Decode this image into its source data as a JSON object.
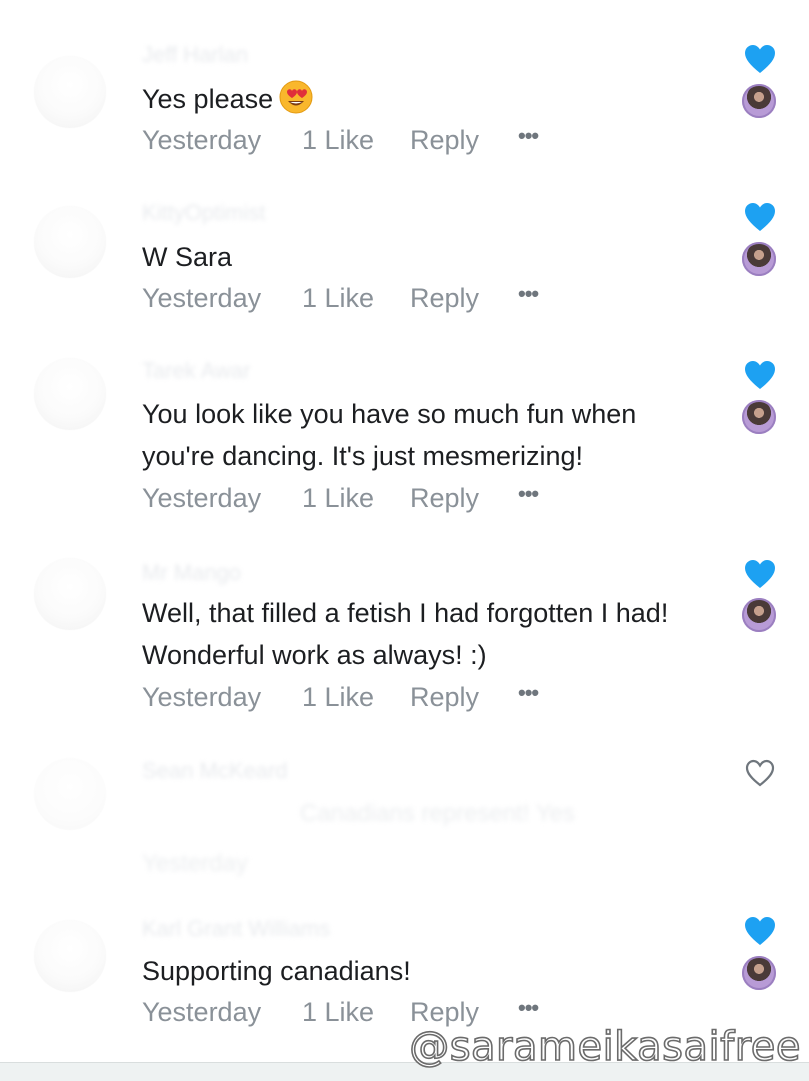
{
  "comments": [
    {
      "author": "Jeff Harlan",
      "text": "Yes please",
      "emoji": "heart-eyes",
      "time": "Yesterday",
      "likes": "1 Like",
      "reply": "Reply",
      "more": "•••",
      "liked": true
    },
    {
      "author": "KittyOptimist",
      "text": "W Sara",
      "time": "Yesterday",
      "likes": "1 Like",
      "reply": "Reply",
      "more": "•••",
      "liked": true
    },
    {
      "author": "Tarek Awar",
      "text": "You look like you have so much fun when you're dancing. It's just mesmerizing!",
      "time": "Yesterday",
      "likes": "1 Like",
      "reply": "Reply",
      "more": "•••",
      "liked": true
    },
    {
      "author": "Mr Mango",
      "text": "Well, that filled a fetish I had forgotten I had! Wonderful work as always! :)",
      "time": "Yesterday",
      "likes": "1 Like",
      "reply": "Reply",
      "more": "•••",
      "liked": true
    },
    {
      "author": "Sean McKeard",
      "text": "Canadians represent! Yes",
      "time": "Yesterday",
      "liked": false
    },
    {
      "author": "Karl Grant Williams",
      "text": "Supporting canadians!",
      "time": "Yesterday",
      "likes": "1 Like",
      "reply": "Reply",
      "more": "•••",
      "liked": true
    }
  ],
  "watermark": "@sarameikasaifree",
  "colors": {
    "heart": "#1da1f2",
    "meta": "#8a9198",
    "text": "#1c1e21"
  }
}
